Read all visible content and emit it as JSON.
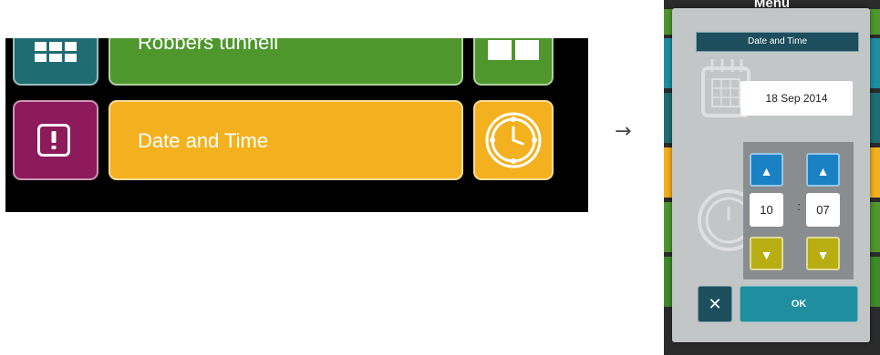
{
  "menu_crop": {
    "tiles": [
      {
        "label": "Robbers tunnell",
        "color": "#4f972d"
      },
      {
        "label": "Date and Time",
        "color": "#f3b11f"
      }
    ],
    "icons": [
      "grid-icon",
      "split-screen-icon",
      "alert-icon",
      "clock-icon"
    ]
  },
  "arrow": "→",
  "device": {
    "menu_title": "Menu",
    "dialog": {
      "title": "Date and Time",
      "date": "18 Sep 2014",
      "time": {
        "hours": "10",
        "separator": ":",
        "minutes": "07",
        "up_symbol": "▲",
        "down_symbol": "▼"
      },
      "cancel_symbol": "✕",
      "ok_label": "OK"
    }
  },
  "colors": {
    "dialog_bg": "#c3c6c7",
    "title_bar": "#1c4e5d",
    "up_button": "#1a82c4",
    "down_button": "#b8ae14",
    "ok_button": "#1f8fa0"
  }
}
